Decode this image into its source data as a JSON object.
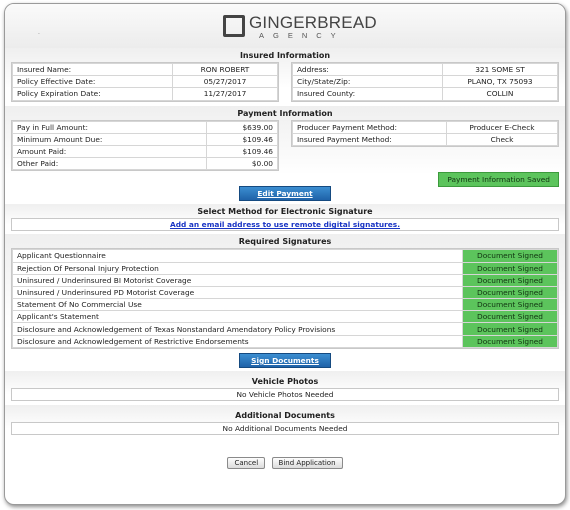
{
  "brand": {
    "name": "GINGERBREAD",
    "sub": "AGENCY"
  },
  "insured": {
    "title": "Insured Information",
    "left": [
      {
        "label": "Insured Name:",
        "value": "RON ROBERT"
      },
      {
        "label": "Policy Effective Date:",
        "value": "05/27/2017"
      },
      {
        "label": "Policy Expiration Date:",
        "value": "11/27/2017"
      }
    ],
    "right": [
      {
        "label": "Address:",
        "value": "321 SOME ST"
      },
      {
        "label": "City/State/Zip:",
        "value": "PLANO, TX 75093"
      },
      {
        "label": "Insured County:",
        "value": "COLLIN"
      }
    ]
  },
  "payment": {
    "title": "Payment Information",
    "left": [
      {
        "label": "Pay in Full Amount:",
        "value": "$639.00"
      },
      {
        "label": "Minimum Amount Due:",
        "value": "$109.46"
      },
      {
        "label": "Amount Paid:",
        "value": "$109.46"
      },
      {
        "label": "Other Paid:",
        "value": "$0.00"
      }
    ],
    "right": [
      {
        "label": "Producer Payment Method:",
        "value": "Producer E-Check"
      },
      {
        "label": "Insured Payment Method:",
        "value": "Check"
      }
    ],
    "saved_label": "Payment Information Saved",
    "edit_label": "Edit Payment"
  },
  "esign": {
    "title": "Select Method for Electronic Signature",
    "link_label": "Add an email address to use remote digital signatures."
  },
  "signatures": {
    "title": "Required Signatures",
    "rows": [
      {
        "doc": "Applicant Questionnaire",
        "status": "Document Signed"
      },
      {
        "doc": "Rejection Of Personal Injury Protection",
        "status": "Document Signed"
      },
      {
        "doc": "Uninsured / Underinsured BI Motorist Coverage",
        "status": "Document Signed"
      },
      {
        "doc": "Uninsured / Underinsured PD Motorist Coverage",
        "status": "Document Signed"
      },
      {
        "doc": "Statement Of No Commercial Use",
        "status": "Document Signed"
      },
      {
        "doc": "Applicant's Statement",
        "status": "Document Signed"
      },
      {
        "doc": "Disclosure and Acknowledgement of Texas Nonstandard Amendatory Policy Provisions",
        "status": "Document Signed"
      },
      {
        "doc": "Disclosure and Acknowledgement of Restrictive Endorsements",
        "status": "Document Signed"
      }
    ],
    "sign_label": "Sign Documents"
  },
  "photos": {
    "title": "Vehicle Photos",
    "message": "No Vehicle Photos Needed"
  },
  "additional": {
    "title": "Additional Documents",
    "message": "No Additional Documents Needed"
  },
  "footer": {
    "cancel_label": "Cancel",
    "bind_label": "Bind Application"
  },
  "colors": {
    "signed_green": "#5cc45c",
    "button_blue": "#2b74bd",
    "link_blue": "#1a35c4"
  }
}
